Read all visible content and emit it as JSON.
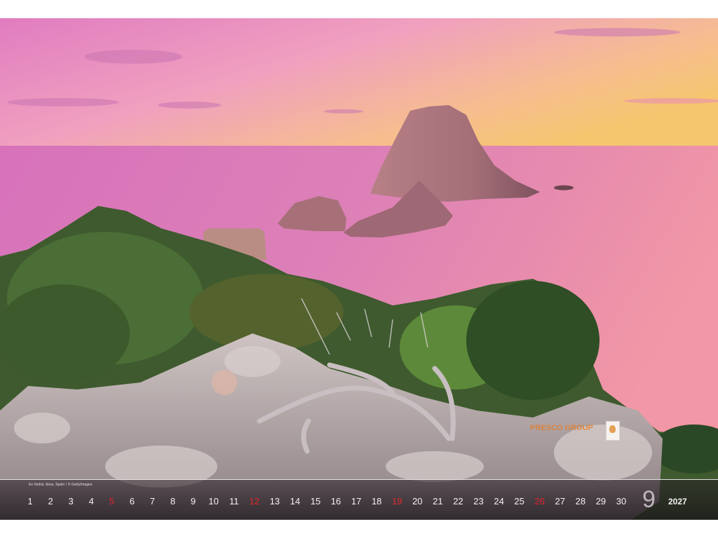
{
  "photo": {
    "subject": "ocean-cliffs-sunset-photo",
    "colors": {
      "sky_top": "#e883c2",
      "sky_mid": "#f1a1b8",
      "sky_warm": "#f7c67a",
      "sea": "#d977b8",
      "rock": "#a9747e",
      "foliage": "#4a6b34",
      "stone": "#c7bcbd"
    }
  },
  "credit": "Es Vedrà, Ibiza, Spain / © GettyImages",
  "calendar": {
    "days": [
      {
        "n": "1",
        "red": false
      },
      {
        "n": "2",
        "red": false
      },
      {
        "n": "3",
        "red": false
      },
      {
        "n": "4",
        "red": false
      },
      {
        "n": "5",
        "red": true
      },
      {
        "n": "6",
        "red": false
      },
      {
        "n": "7",
        "red": false
      },
      {
        "n": "8",
        "red": false
      },
      {
        "n": "9",
        "red": false
      },
      {
        "n": "10",
        "red": false
      },
      {
        "n": "11",
        "red": false
      },
      {
        "n": "12",
        "red": true
      },
      {
        "n": "13",
        "red": false
      },
      {
        "n": "14",
        "red": false
      },
      {
        "n": "15",
        "red": false
      },
      {
        "n": "16",
        "red": false
      },
      {
        "n": "17",
        "red": false
      },
      {
        "n": "18",
        "red": false
      },
      {
        "n": "19",
        "red": true
      },
      {
        "n": "20",
        "red": false
      },
      {
        "n": "21",
        "red": false
      },
      {
        "n": "22",
        "red": false
      },
      {
        "n": "23",
        "red": false
      },
      {
        "n": "24",
        "red": false
      },
      {
        "n": "25",
        "red": false
      },
      {
        "n": "26",
        "red": true
      },
      {
        "n": "27",
        "red": false
      },
      {
        "n": "28",
        "red": false
      },
      {
        "n": "29",
        "red": false
      },
      {
        "n": "30",
        "red": false
      }
    ],
    "month": "9",
    "year": "2027"
  },
  "logo": {
    "text": "PRESCO GROUP",
    "icon": "logo-mark-icon"
  }
}
